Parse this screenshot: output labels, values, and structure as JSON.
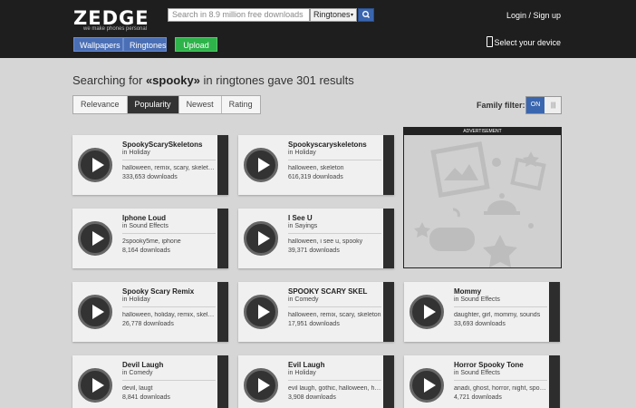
{
  "header": {
    "logo_text": "ZEDGE",
    "tagline": "we make phones personal",
    "search_placeholder": "Search in 8.9 million free downloads",
    "search_category": "Ringtones",
    "login": "Login / Sign up",
    "nav": {
      "wallpapers": "Wallpapers",
      "ringtones": "Ringtones",
      "upload": "Upload"
    },
    "select_device": "Select your device"
  },
  "results": {
    "prefix": "Searching for ",
    "query": "«spooky»",
    "suffix": " in ringtones gave 301 results"
  },
  "sort_tabs": [
    "Relevance",
    "Popularity",
    "Newest",
    "Rating"
  ],
  "active_sort": "Popularity",
  "family_filter": {
    "label": "Family filter:",
    "state": "ON"
  },
  "ad_label": "ADVERTISEMENT",
  "colors": {
    "accent": "#3a66b0",
    "upload": "#2eb34a",
    "topbar": "#1e1e1e"
  },
  "cards": [
    {
      "title": "SpookyScarySkeletons",
      "category": "in Holiday",
      "tags": "halloween, remix, scary, skeletons",
      "downloads": "333,653 downloads"
    },
    {
      "title": "Spookyscaryskeletons",
      "category": "in Holiday",
      "tags": "halloween, skeleton",
      "downloads": "616,319 downloads"
    },
    {
      "title": "Iphone Loud",
      "category": "in Sound Effects",
      "tags": "2spooky5me, iphone",
      "downloads": "8,164 downloads"
    },
    {
      "title": "I See U",
      "category": "in Sayings",
      "tags": "halloween, i see u, spooky",
      "downloads": "39,371 downloads"
    },
    {
      "title": "Spooky Scary Remix",
      "category": "in Holiday",
      "tags": "halloween, holiday, remix, skeleton",
      "downloads": "26,778 downloads"
    },
    {
      "title": "SPOOKY SCARY SKEL",
      "category": "in Comedy",
      "tags": "halloween, remix, scary, skeleton",
      "downloads": "17,951 downloads"
    },
    {
      "title": "Mommy",
      "category": "in Sound Effects",
      "tags": "daughter, girl, mommy, sounds",
      "downloads": "33,693 downloads"
    },
    {
      "title": "Devil Laugh",
      "category": "in Comedy",
      "tags": "devil, laugt",
      "downloads": "8,841 downloads"
    },
    {
      "title": "Evil Laugh",
      "category": "in Holiday",
      "tags": "evil laugh, gothic, halloween, horror",
      "downloads": "3,908 downloads"
    },
    {
      "title": "Horror Spooky Tone",
      "category": "in Sound Effects",
      "tags": "anadi, ghost, horror, night, spooky",
      "downloads": "4,721 downloads"
    }
  ]
}
